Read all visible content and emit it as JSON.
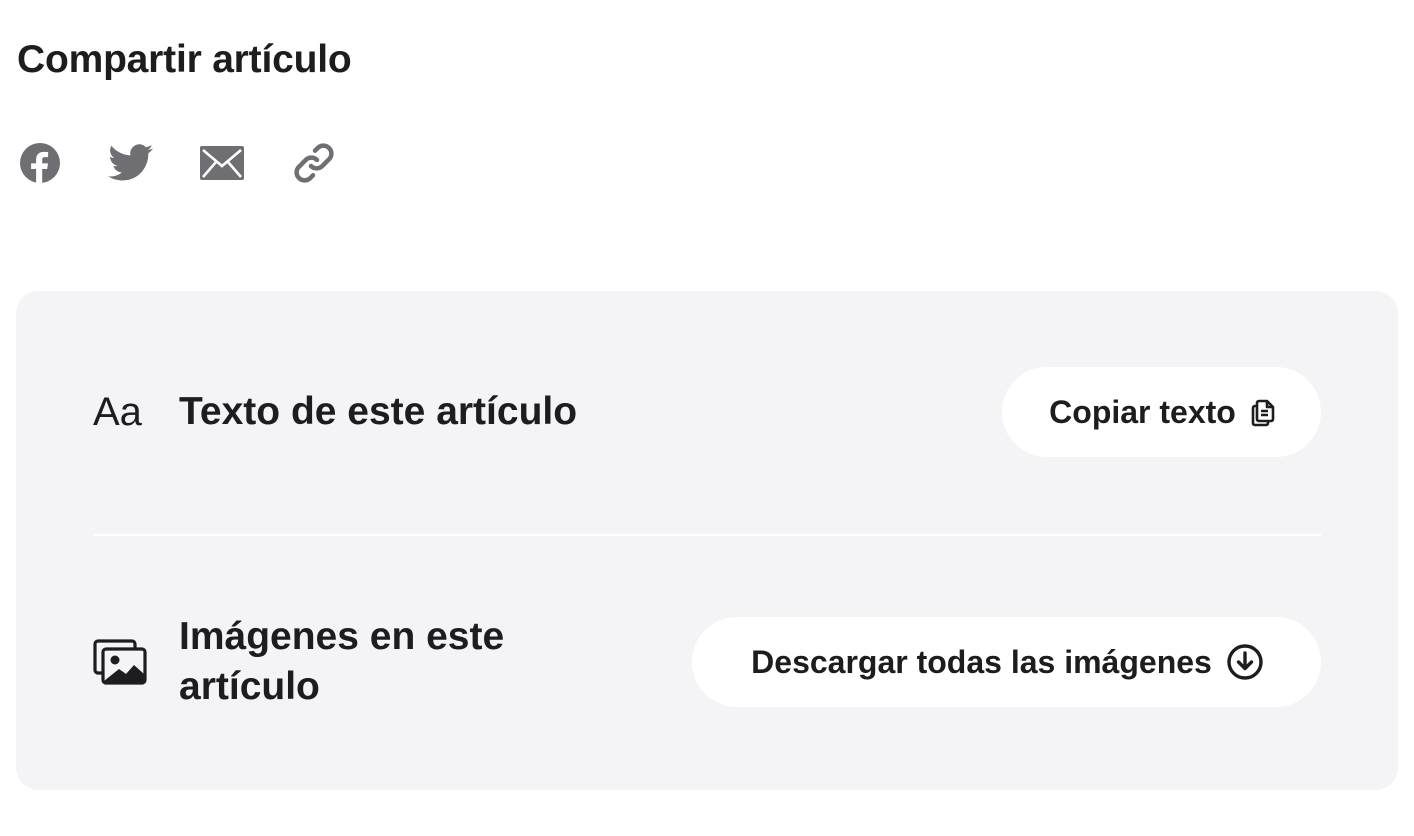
{
  "share": {
    "title": "Compartir artículo",
    "icons": [
      "facebook-icon",
      "twitter-icon",
      "email-icon",
      "link-icon"
    ],
    "icon_color": "#6e6e73"
  },
  "panel": {
    "background": "#f4f4f6",
    "text_row": {
      "icon_text": "Aa",
      "label": "Texto de este artículo",
      "button_label": "Copiar texto",
      "button_icon": "copy-icon"
    },
    "images_row": {
      "icon": "images-icon",
      "label": "Imágenes en este artículo",
      "button_label": "Descargar todas las imágenes",
      "button_icon": "download-circle-icon"
    }
  }
}
